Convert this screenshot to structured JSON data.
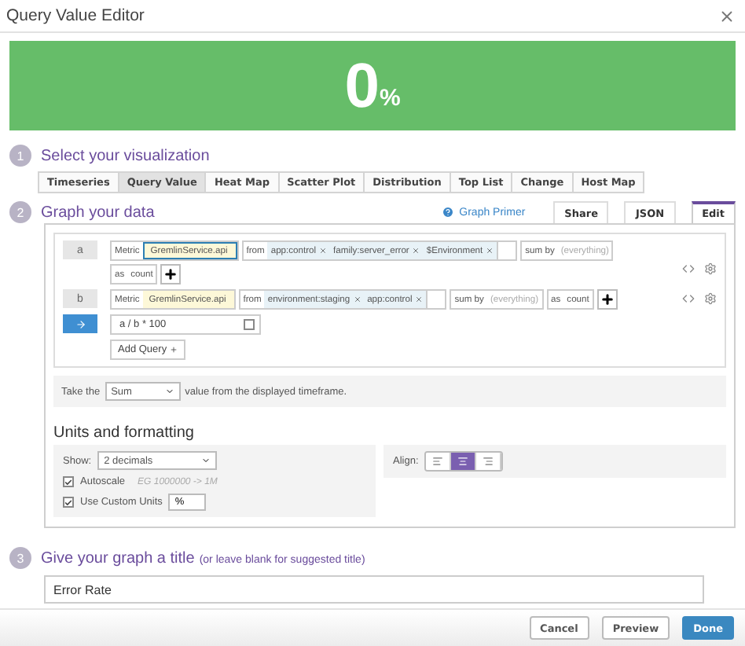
{
  "window": {
    "title": "Query Value Editor"
  },
  "preview": {
    "value": "0",
    "unit": "%"
  },
  "step1": {
    "number": "1",
    "title": "Select your visualization",
    "types": [
      {
        "label": "Timeseries",
        "selected": false
      },
      {
        "label": "Query Value",
        "selected": true
      },
      {
        "label": "Heat Map",
        "selected": false
      },
      {
        "label": "Scatter Plot",
        "selected": false
      },
      {
        "label": "Distribution",
        "selected": false
      },
      {
        "label": "Top List",
        "selected": false
      },
      {
        "label": "Change",
        "selected": false
      },
      {
        "label": "Host Map",
        "selected": false
      }
    ]
  },
  "step2": {
    "number": "2",
    "title": "Graph your data",
    "help_link": "Graph Primer",
    "tabs": [
      {
        "label": "Share",
        "selected": false
      },
      {
        "label": "JSON",
        "selected": false
      },
      {
        "label": "Edit",
        "selected": true
      }
    ],
    "queries": [
      {
        "kind": "metric",
        "label": "a",
        "metric_label": "Metric",
        "metric": "GremlinService.api",
        "focused": true,
        "from_label": "from",
        "tags": [
          "app:control",
          "family:server_error",
          "$Environment"
        ],
        "sum_by_label": "sum by",
        "sum_by": "(everything)",
        "as_label": "as",
        "as_value": "count"
      },
      {
        "kind": "metric",
        "label": "b",
        "metric_label": "Metric",
        "metric": "GremlinService.api",
        "focused": false,
        "from_label": "from",
        "tags": [
          "environment:staging",
          "app:control"
        ],
        "sum_by_label": "sum by",
        "sum_by": "(everything)",
        "as_label": "as",
        "as_value": "count"
      },
      {
        "kind": "formula",
        "formula": "a / b * 100"
      }
    ],
    "add_query": "Add Query",
    "aggregation": {
      "prefix": "Take the",
      "value": "Sum",
      "suffix": "value from the displayed timeframe."
    },
    "units": {
      "title": "Units and formatting",
      "show_label": "Show:",
      "show_value": "2 decimals",
      "options": [
        {
          "label": "Autoscale",
          "checked": true,
          "hint": "EG 1000000 -> 1M"
        },
        {
          "label": "Use Custom Units",
          "checked": true,
          "value": "%"
        }
      ],
      "align_label": "Align:",
      "align": [
        {
          "kind": "left",
          "selected": false
        },
        {
          "kind": "center",
          "selected": true
        },
        {
          "kind": "right",
          "selected": false
        }
      ]
    }
  },
  "step3": {
    "number": "3",
    "title": "Give your graph a title",
    "hint": "(or leave blank for suggested title)",
    "value": "Error Rate"
  },
  "buttons": [
    {
      "label": "Cancel",
      "kind": "default"
    },
    {
      "label": "Preview",
      "kind": "default"
    },
    {
      "label": "Done",
      "kind": "primary"
    }
  ]
}
